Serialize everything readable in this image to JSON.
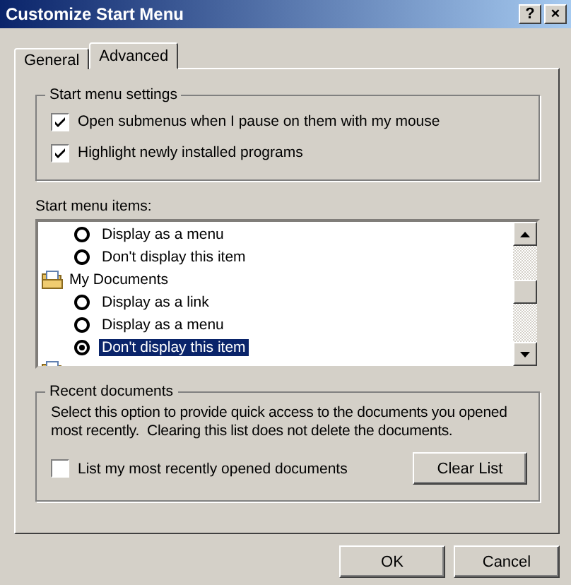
{
  "window": {
    "title": "Customize Start Menu",
    "help_button": "?",
    "close_button": "×"
  },
  "tabs": [
    {
      "label": "General",
      "selected": false
    },
    {
      "label": "Advanced",
      "selected": true
    }
  ],
  "start_menu_settings": {
    "title": "Start menu settings",
    "options": [
      {
        "label": "Open submenus when I pause on them with my mouse",
        "checked": true
      },
      {
        "label": "Highlight newly installed programs",
        "checked": true
      }
    ]
  },
  "start_menu_items": {
    "label": "Start menu items:",
    "items": [
      {
        "kind": "radio",
        "label": "Display as a menu",
        "checked": false,
        "selected": false
      },
      {
        "kind": "radio",
        "label": "Don't display this item",
        "checked": false,
        "selected": false
      },
      {
        "kind": "folder",
        "label": "My Documents",
        "children": [
          {
            "kind": "radio",
            "label": "Display as a link",
            "checked": false,
            "selected": false
          },
          {
            "kind": "radio",
            "label": "Display as a menu",
            "checked": false,
            "selected": false
          },
          {
            "kind": "radio",
            "label": "Don't display this item",
            "checked": true,
            "selected": true
          }
        ]
      },
      {
        "kind": "folder"
      }
    ]
  },
  "recent_documents": {
    "title": "Recent documents",
    "description": "Select this option to provide quick access to the documents you opened most recently.  Clearing this list does not delete the documents.",
    "option": {
      "label": "List my most recently opened documents",
      "checked": false
    },
    "button": "Clear List"
  },
  "buttons": [
    "OK",
    "Cancel"
  ]
}
